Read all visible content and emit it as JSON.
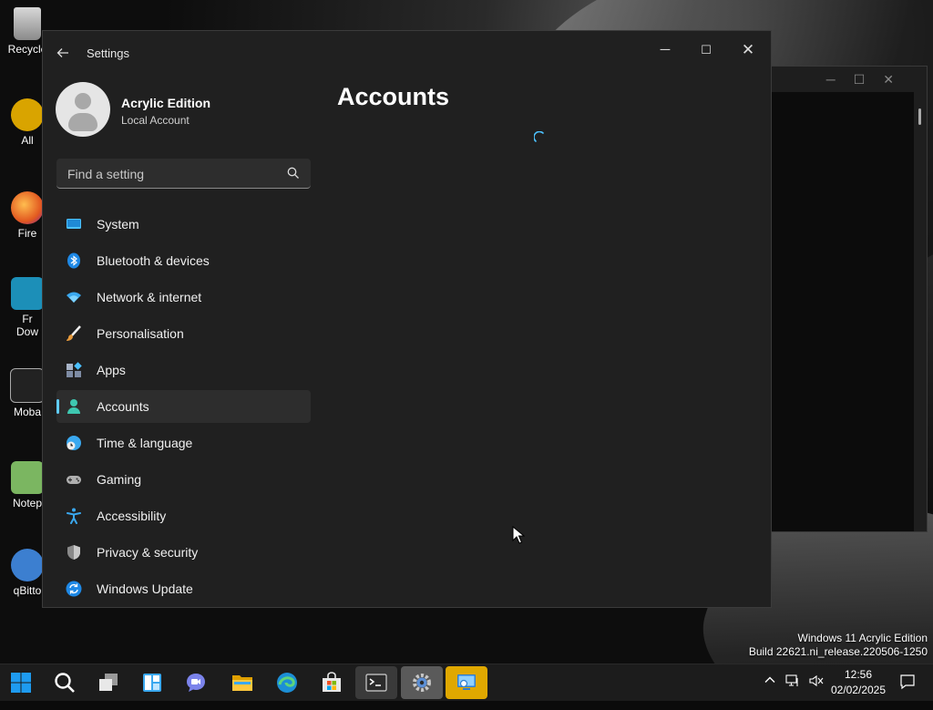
{
  "desktop": {
    "icons": [
      {
        "label": "Recycle",
        "name": "recycle-bin-icon"
      },
      {
        "label": "All",
        "name": "all-icon"
      },
      {
        "label": "Fire",
        "name": "firefox-icon"
      },
      {
        "label": "Fr\nDow",
        "name": "free-download-icon"
      },
      {
        "label": "Moba",
        "name": "mobaxterm-icon"
      },
      {
        "label": "Notep",
        "name": "notepad-icon"
      },
      {
        "label": "qBitto",
        "name": "qbittorrent-icon"
      }
    ]
  },
  "window": {
    "title": "Settings",
    "back_icon": "back-arrow-icon",
    "controls": {
      "minimize": "─",
      "maximize": "☐",
      "close": "✕"
    }
  },
  "profile": {
    "name": "Acrylic Edition",
    "account_type": "Local Account"
  },
  "search": {
    "placeholder": "Find a setting",
    "value": ""
  },
  "nav": {
    "items": [
      {
        "label": "System",
        "icon": "system-icon",
        "active": false
      },
      {
        "label": "Bluetooth & devices",
        "icon": "bluetooth-icon",
        "active": false
      },
      {
        "label": "Network & internet",
        "icon": "wifi-icon",
        "active": false
      },
      {
        "label": "Personalisation",
        "icon": "brush-icon",
        "active": false
      },
      {
        "label": "Apps",
        "icon": "apps-icon",
        "active": false
      },
      {
        "label": "Accounts",
        "icon": "person-icon",
        "active": true
      },
      {
        "label": "Time & language",
        "icon": "globe-clock-icon",
        "active": false
      },
      {
        "label": "Gaming",
        "icon": "gamepad-icon",
        "active": false
      },
      {
        "label": "Accessibility",
        "icon": "accessibility-icon",
        "active": false
      },
      {
        "label": "Privacy & security",
        "icon": "shield-icon",
        "active": false
      },
      {
        "label": "Windows Update",
        "icon": "update-icon",
        "active": false
      }
    ]
  },
  "main": {
    "page_title": "Accounts",
    "loading": true
  },
  "watermark": {
    "line1": "Windows 11 Acrylic Edition",
    "line2": "Build 22621.ni_release.220506-1250"
  },
  "taskbar": {
    "apps": [
      "start-icon",
      "search-icon",
      "task-view-icon",
      "widgets-icon",
      "chat-icon",
      "file-explorer-icon",
      "edge-icon",
      "store-icon",
      "terminal-icon",
      "settings-icon",
      "remote-desktop-icon"
    ],
    "time": "12:56",
    "date": "02/02/2025"
  },
  "colors": {
    "accent": "#60cdff",
    "window_bg": "#202020",
    "taskbar_bg": "#1c1c1c"
  }
}
